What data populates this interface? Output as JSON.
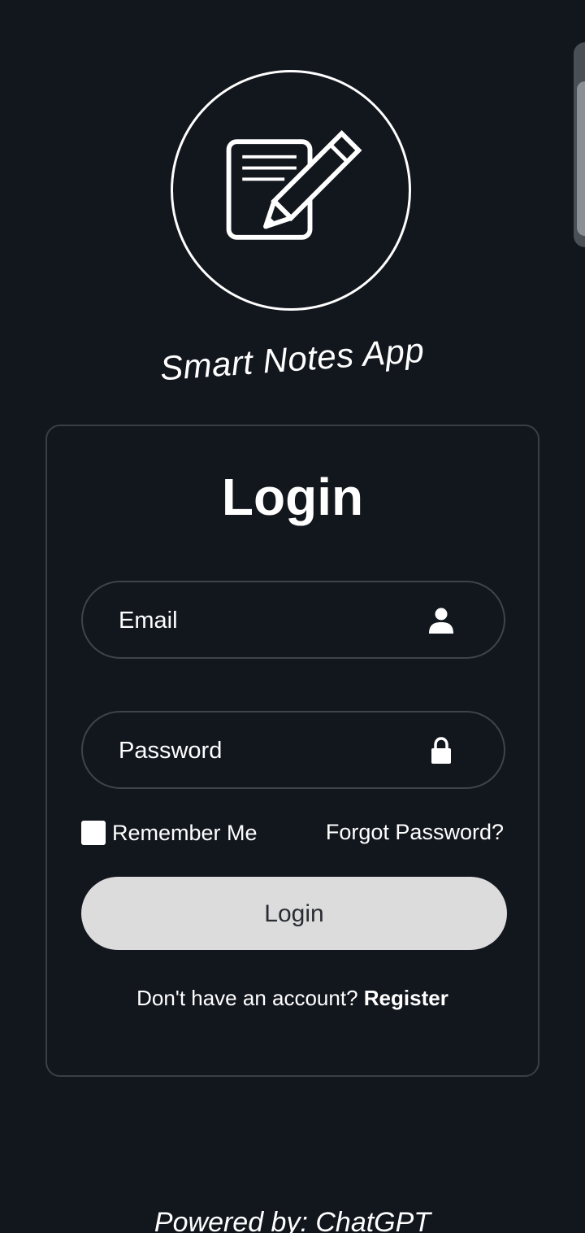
{
  "app": {
    "name": "Smart Notes App",
    "logo_icon": "notepad-pencil-icon"
  },
  "login_card": {
    "title": "Login",
    "email": {
      "placeholder": "Email",
      "value": "",
      "icon": "user-icon"
    },
    "password": {
      "placeholder": "Password",
      "value": "",
      "icon": "lock-icon"
    },
    "remember_me": {
      "label": "Remember Me",
      "checked": false
    },
    "forgot_password_label": "Forgot Password?",
    "login_button_label": "Login",
    "register_prompt": "Don't have an account?",
    "register_link_label": "Register"
  },
  "footer": {
    "powered_by": "Powered by: ChatGPT"
  },
  "colors": {
    "background": "#12161d",
    "card_border": "#3a3f47",
    "button_bg": "#dcdcdc",
    "button_text": "#2a2d33",
    "text": "#ffffff"
  }
}
